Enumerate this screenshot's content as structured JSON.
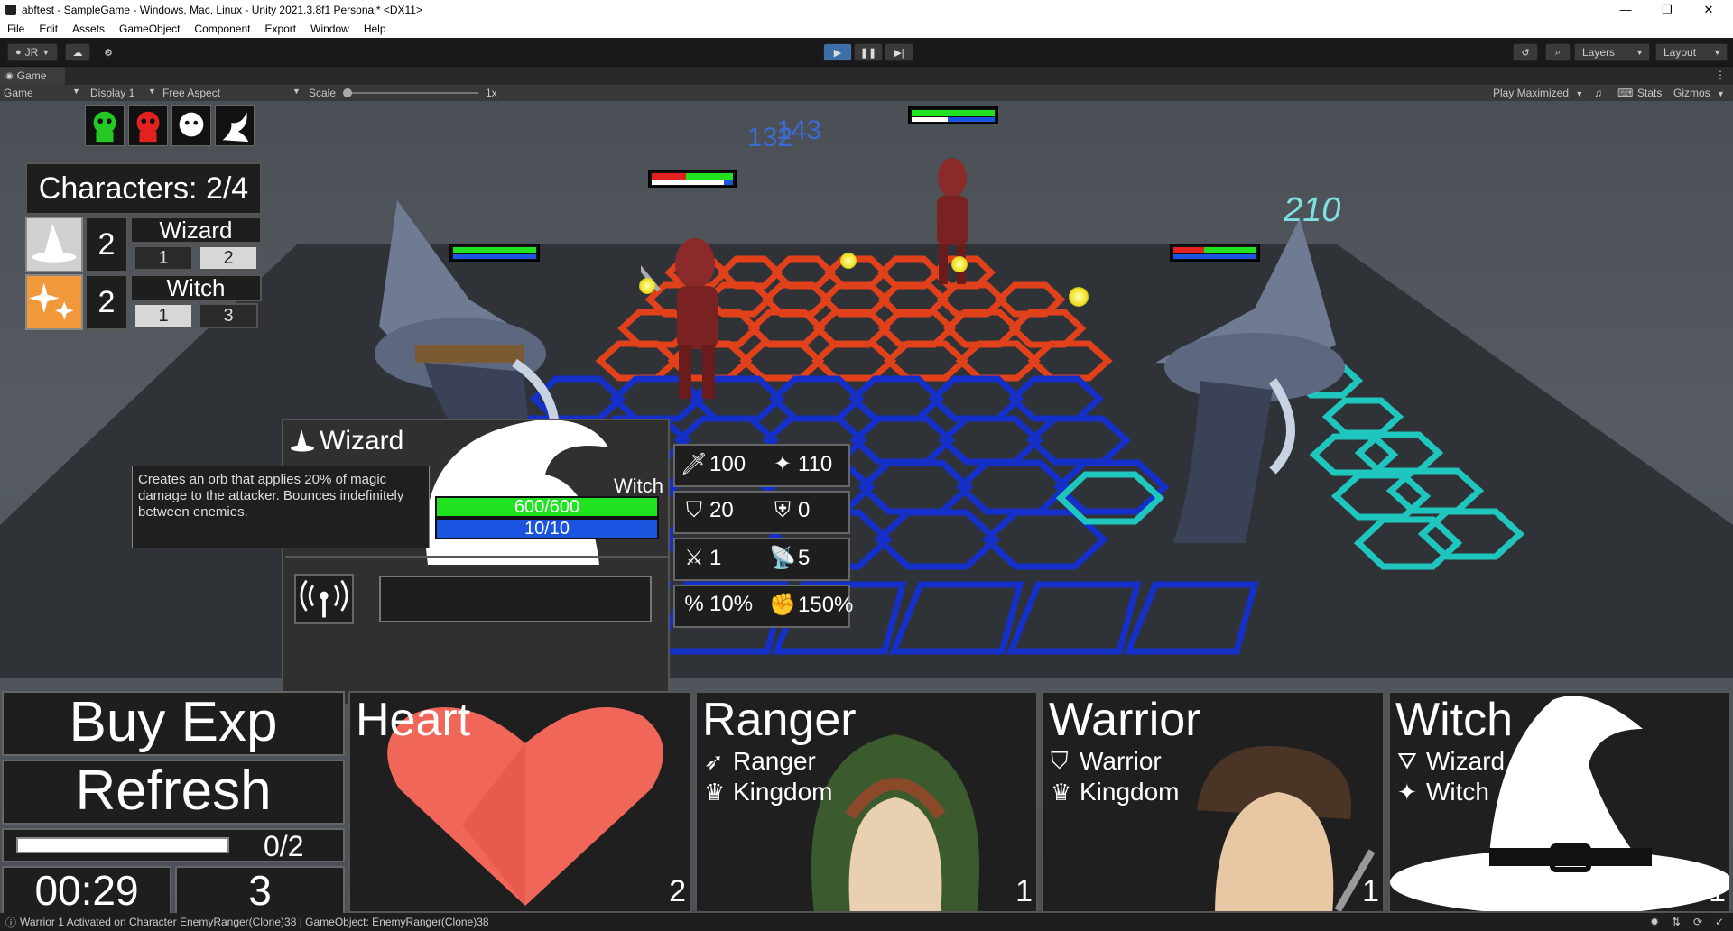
{
  "window": {
    "title": "abftest - SampleGame - Windows, Mac, Linux - Unity 2021.3.8f1 Personal* <DX11>",
    "controls": [
      "—",
      "❐",
      "✕"
    ]
  },
  "menu": [
    "File",
    "Edit",
    "Assets",
    "GameObject",
    "Component",
    "Export",
    "Window",
    "Help"
  ],
  "toolbar": {
    "account": "JR",
    "layers": "Layers",
    "layout": "Layout"
  },
  "game_tab": {
    "label": "Game",
    "view_select": "Game",
    "display": "Display 1",
    "aspect": "Free Aspect",
    "scale_label": "Scale",
    "scale_value": "1x",
    "play_mode": "Play Maximized",
    "stats": "Stats",
    "gizmos": "Gizmos"
  },
  "colors": {
    "hp_green": "#21e221",
    "mana_blue": "#1b54e0",
    "enemy_red": "#e22121",
    "hex_red": "#e0401a",
    "hex_blue": "#1530c8",
    "hex_cyan": "#1fc6bd",
    "floor_dark": "#2f3338",
    "heart": "#f0675a",
    "damage_blue": "#3a6bd6",
    "damage_cyan": "#7fe0e0"
  },
  "damage_numbers": [
    "132",
    "143",
    "210"
  ],
  "characters_panel": {
    "title": "Characters: 2/4",
    "rows": [
      {
        "icon": "wizard-hat-icon",
        "count": "2",
        "name": "Wizard",
        "tiers": [
          "1",
          "2"
        ]
      },
      {
        "icon": "sparkle-icon",
        "count": "2",
        "name": "Witch",
        "tiers": [
          "1",
          "3"
        ]
      }
    ]
  },
  "selected_unit": {
    "name": "Wizard",
    "trait_label": "Witch",
    "hp": "600/600",
    "mana": "10/10",
    "ability_text": "Creates an orb that applies 20% of magic damage to the attacker. Bounces indefinitely between enemies.",
    "stats": [
      {
        "icon": "sword-icon",
        "value": "100"
      },
      {
        "icon": "sparkle-icon",
        "value": "110"
      },
      {
        "icon": "shield-icon",
        "value": "20"
      },
      {
        "icon": "magic-shield-icon",
        "value": "0"
      },
      {
        "icon": "crossed-swords-icon",
        "value": "1"
      },
      {
        "icon": "range-antenna-icon",
        "value": "5"
      },
      {
        "icon": "percent-icon",
        "value": "10%"
      },
      {
        "icon": "crit-fist-icon",
        "value": "150%"
      }
    ]
  },
  "shop": {
    "buy_exp": "Buy Exp",
    "refresh": "Refresh",
    "exp_text": "0/2",
    "exp_progress": 0,
    "timer": "00:29",
    "gold": "3",
    "cards": [
      {
        "name": "Heart",
        "traits": [],
        "cost": "2"
      },
      {
        "name": "Ranger",
        "traits": [
          {
            "icon": "bow-icon",
            "label": "Ranger"
          },
          {
            "icon": "crown-icon",
            "label": "Kingdom"
          }
        ],
        "cost": "1"
      },
      {
        "name": "Warrior",
        "traits": [
          {
            "icon": "shield-icon",
            "label": "Warrior"
          },
          {
            "icon": "crown-icon",
            "label": "Kingdom"
          }
        ],
        "cost": "1"
      },
      {
        "name": "Witch",
        "traits": [
          {
            "icon": "wizard-hat-icon",
            "label": "Wizard"
          },
          {
            "icon": "sparkle-icon",
            "label": "Witch"
          }
        ],
        "cost": "1"
      }
    ]
  },
  "status": "Warrior 1 Activated on Character EnemyRanger(Clone)38 | GameObject: EnemyRanger(Clone)38"
}
